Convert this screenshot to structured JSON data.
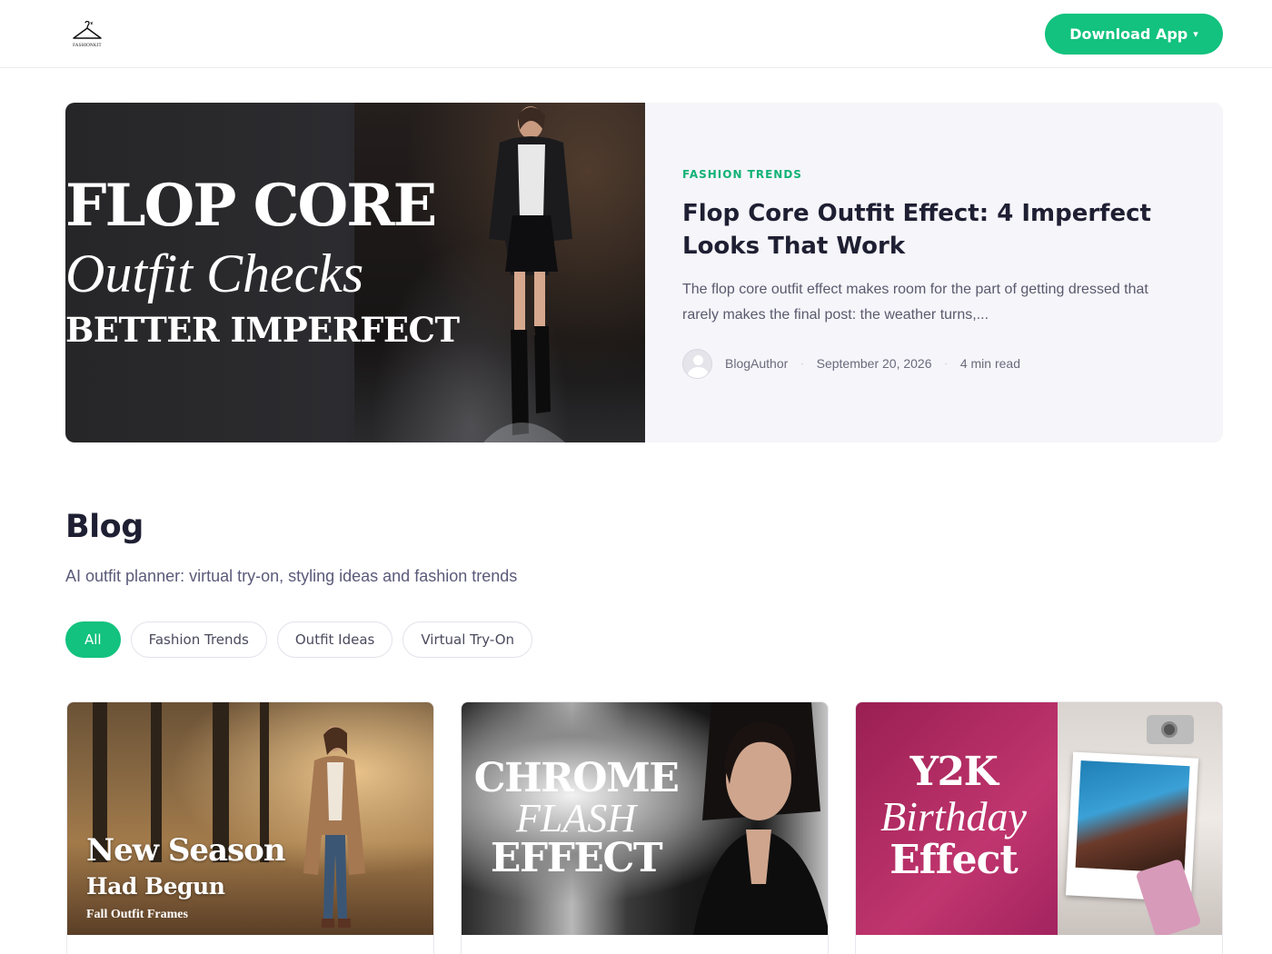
{
  "header": {
    "logo_text": "FASHIONKIT",
    "download_label": "Download App",
    "download_caret": "▾"
  },
  "hero": {
    "image_line1": "FLOP CORE",
    "image_line2": "Outfit Checks",
    "image_line3": "BETTER IMPERFECT",
    "category": "FASHION TRENDS",
    "title": "Flop Core Outfit Effect: 4 Imperfect Looks That Work",
    "excerpt": "The flop core outfit effect makes room for the part of getting dressed that rarely makes the final post: the weather turns,...",
    "author": "BlogAuthor",
    "date": "September 20, 2026",
    "read_time": "4 min read"
  },
  "blog": {
    "title": "Blog",
    "subtitle": "AI outfit planner: virtual try-on, styling ideas and fashion trends",
    "filters": [
      "All",
      "Fashion Trends",
      "Outfit Ideas",
      "Virtual Try-On"
    ],
    "active_filter": "All"
  },
  "cards": [
    {
      "line1": "New Season",
      "line2": "Had Begun",
      "line3": "Fall Outfit Frames"
    },
    {
      "line1": "CHROME",
      "line2": "FLASH",
      "line3": "EFFECT"
    },
    {
      "line1": "Y2K",
      "line2": "Birthday",
      "line3": "Effect"
    }
  ],
  "colors": {
    "accent": "#12c27e",
    "category": "#12b276",
    "heading": "#1f1f33",
    "hero_panel": "#f5f5fa"
  },
  "icons": {
    "logo": "hanger-icon",
    "avatar": "user-avatar-icon"
  }
}
